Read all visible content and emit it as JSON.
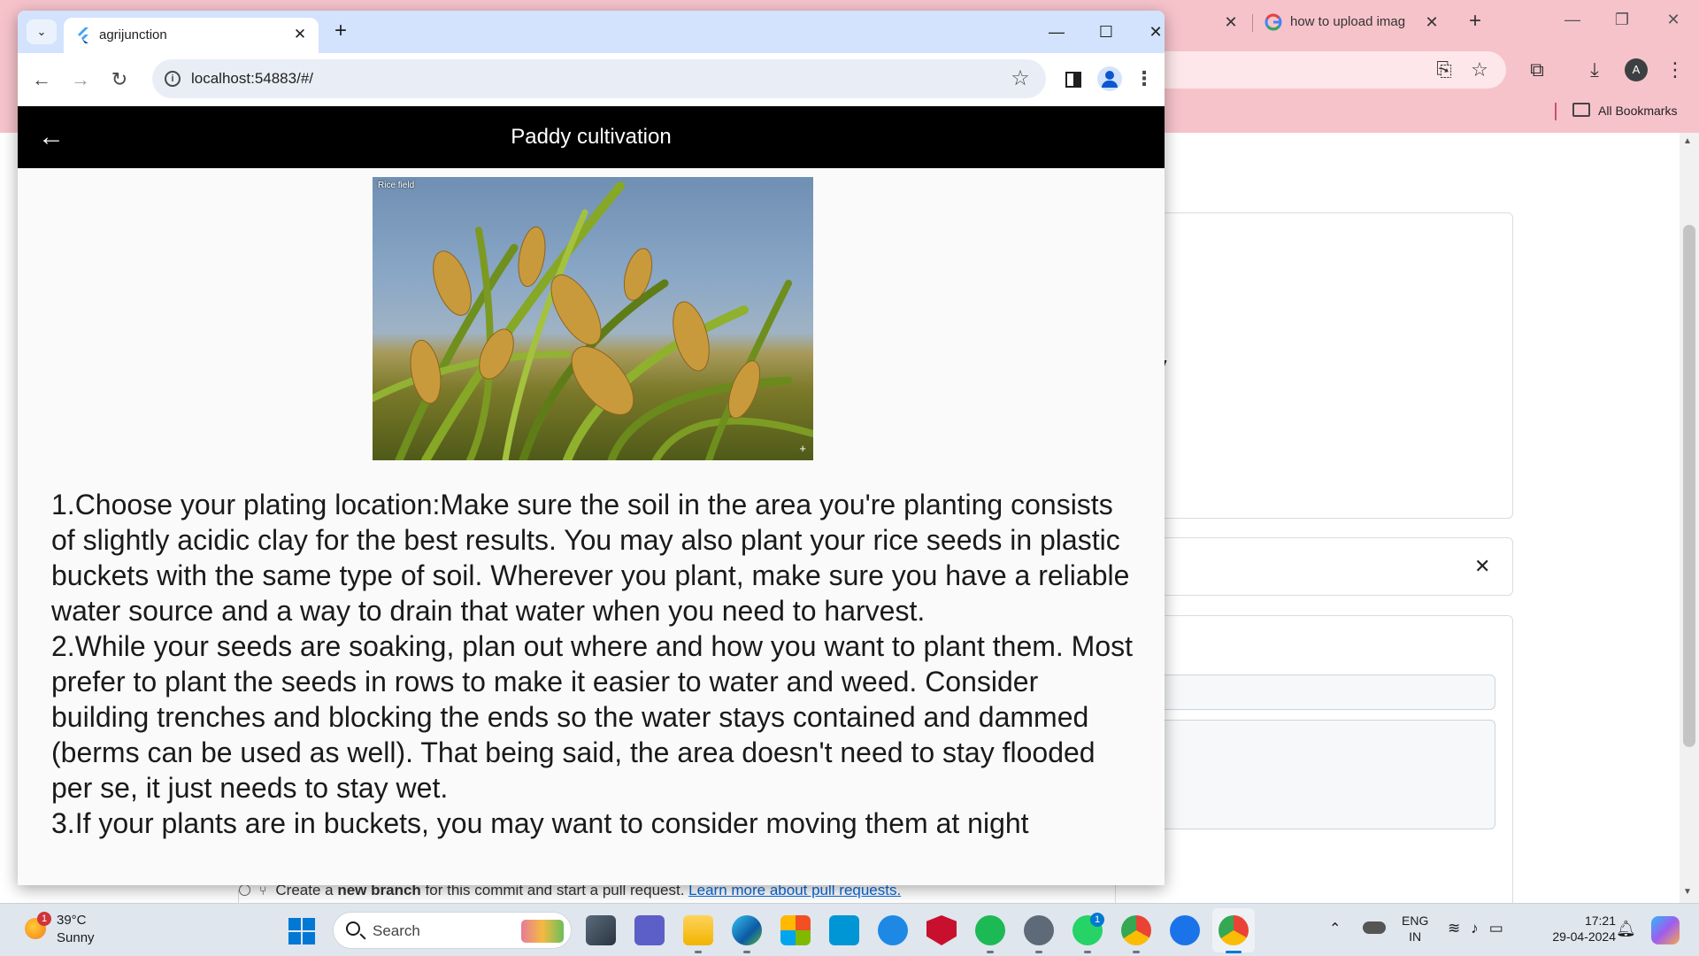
{
  "background_window": {
    "tab_title": "how to upload imag",
    "bookmarks_label": "All Bookmarks",
    "avatar_letter": "A",
    "partial_text": "ry",
    "github_line": {
      "prefix": "Create a ",
      "bold": "new branch",
      "suffix": " for this commit and start a pull request. ",
      "link": "Learn more about pull requests."
    }
  },
  "browser": {
    "tab_title": "agrijunction",
    "url": "localhost:54883/#/"
  },
  "app": {
    "title": "Paddy cultivation",
    "image_caption": "Rice field",
    "instructions": [
      "1.Choose your plating location:Make sure the soil in the area you're planting consists of slightly acidic clay for the best results. You may also plant your rice seeds in plastic buckets with the same type of soil. Wherever you plant, make sure you have a reliable water source and a way to drain that water when you need to harvest.",
      "2.While your seeds are soaking, plan out where and how you want to plant them. Most prefer to plant the seeds in rows to make it easier to water and weed. Consider building trenches and blocking the ends so the water stays contained and dammed (berms can be used as well). That being said, the area doesn't need to stay flooded per se, it just needs to stay wet.",
      "3.If your plants are in buckets, you may want to consider moving them at night"
    ]
  },
  "taskbar": {
    "weather": {
      "temp": "39°C",
      "condition": "Sunny",
      "badge": "1"
    },
    "search_label": "Search",
    "whatsapp_badge": "1",
    "lang_line1": "ENG",
    "lang_line2": "IN",
    "time": "17:21",
    "date": "29-04-2024"
  },
  "colors": {
    "app_bar": "#000000",
    "background_chrome_theme": "#f7c3cb",
    "foreground_chrome_tabbar": "#d3e3fd",
    "link": "#0969da"
  }
}
